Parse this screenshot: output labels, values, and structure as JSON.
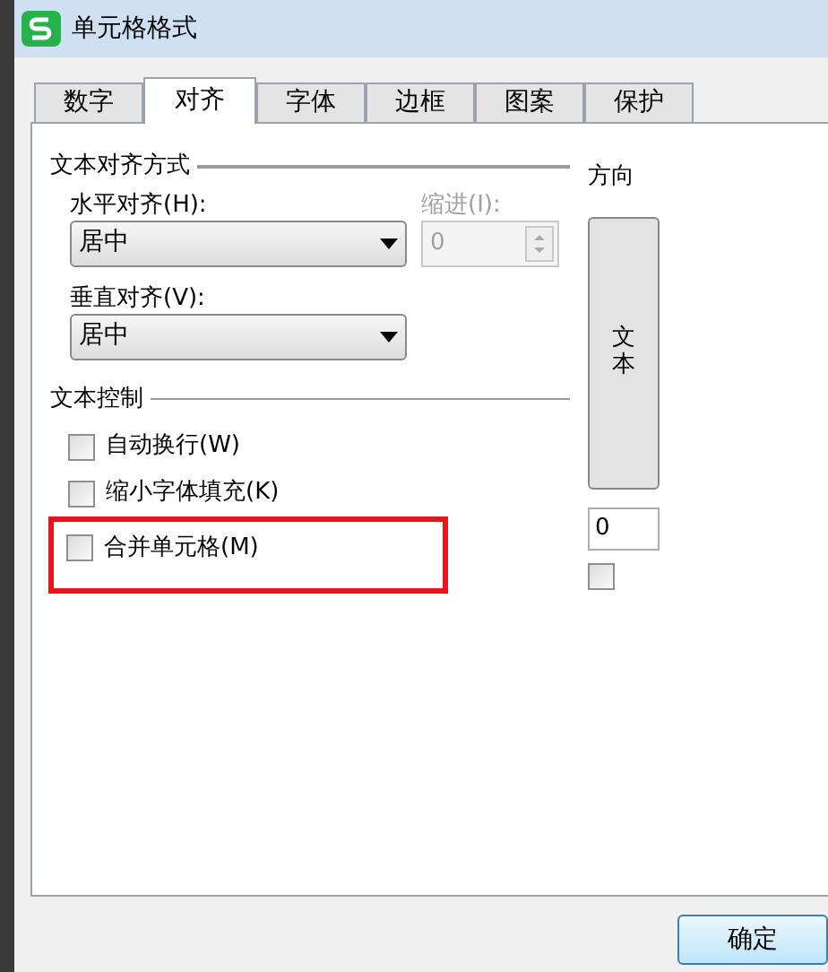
{
  "window": {
    "title": "单元格格式"
  },
  "tabs": [
    {
      "label": "数字",
      "selected": false
    },
    {
      "label": "对齐",
      "selected": true
    },
    {
      "label": "字体",
      "selected": false
    },
    {
      "label": "边框",
      "selected": false
    },
    {
      "label": "图案",
      "selected": false
    },
    {
      "label": "保护",
      "selected": false
    }
  ],
  "alignment": {
    "title": "文本对齐方式",
    "horizontal": {
      "label": "水平对齐(H):",
      "value": "居中"
    },
    "indent": {
      "label": "缩进(I):",
      "value": "0",
      "disabled": true
    },
    "vertical": {
      "label": "垂直对齐(V):",
      "value": "居中"
    }
  },
  "text_control": {
    "title": "文本控制",
    "options": [
      {
        "label": "自动换行(W)",
        "checked": false,
        "highlighted": false
      },
      {
        "label": "缩小字体填充(K)",
        "checked": false,
        "highlighted": false
      },
      {
        "label": "合并单元格(M)",
        "checked": false,
        "highlighted": true
      }
    ]
  },
  "orientation": {
    "title": "方向",
    "vertical_text": "文本",
    "degrees": "0",
    "checkbox_checked": false
  },
  "buttons": [
    "确定"
  ]
}
